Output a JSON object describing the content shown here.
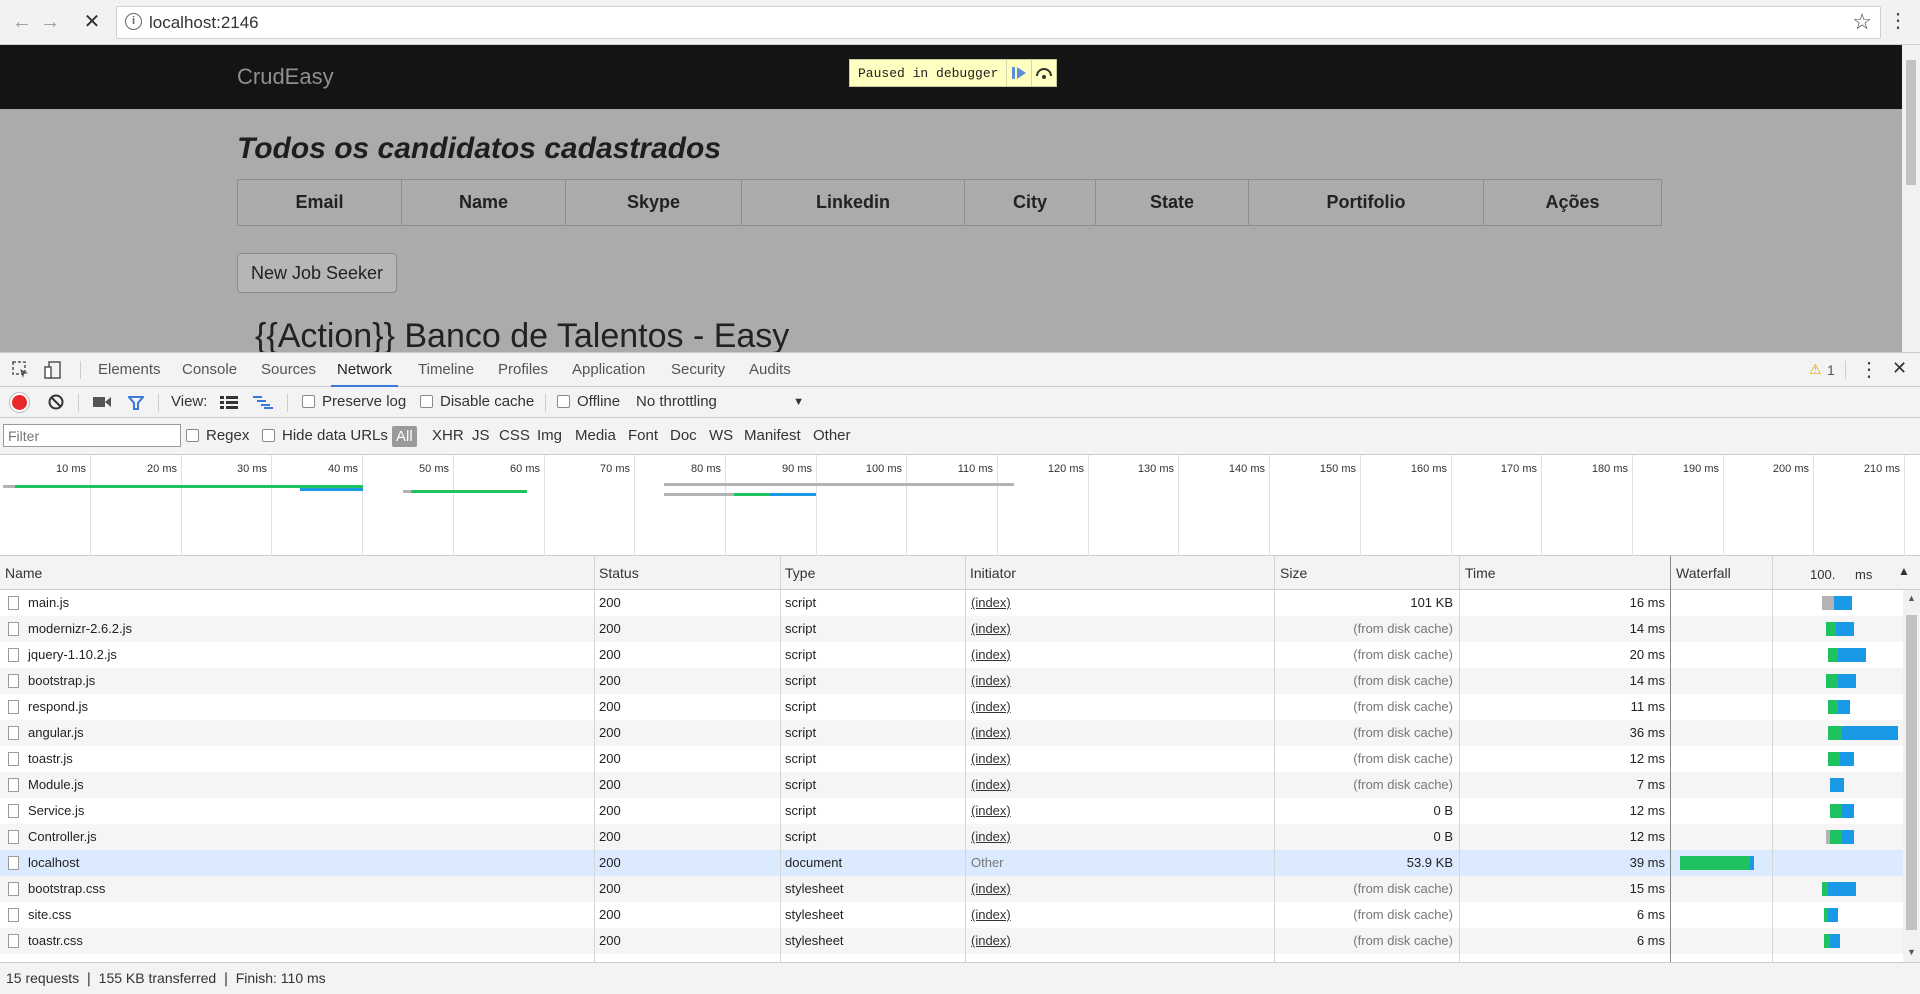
{
  "browser": {
    "url": "localhost:2146",
    "back_icon": "arrow-left-icon",
    "forward_icon": "arrow-right-icon",
    "stop_icon": "close-icon",
    "star_icon": "star-icon",
    "menu_icon": "kebab-icon"
  },
  "page": {
    "brand": "CrudEasy",
    "paused_label": "Paused in debugger",
    "title": "Todos os candidatos cadastrados",
    "columns": [
      "Email",
      "Name",
      "Skype",
      "Linkedin",
      "City",
      "State",
      "Portifolio",
      "Ações"
    ],
    "new_button": "New Job Seeker",
    "subtitle": "{{Action}} Banco de Talentos - Easy"
  },
  "devtools": {
    "tabs": [
      "Elements",
      "Console",
      "Sources",
      "Network",
      "Timeline",
      "Profiles",
      "Application",
      "Security",
      "Audits"
    ],
    "active_tab": "Network",
    "warning_count": "1",
    "toolbar": {
      "view_label": "View:",
      "preserve_log": "Preserve log",
      "disable_cache": "Disable cache",
      "offline": "Offline",
      "throttling": "No throttling"
    },
    "filter": {
      "placeholder": "Filter",
      "regex": "Regex",
      "hide_data_urls": "Hide data URLs",
      "types": [
        "All",
        "XHR",
        "JS",
        "CSS",
        "Img",
        "Media",
        "Font",
        "Doc",
        "WS",
        "Manifest",
        "Other"
      ]
    },
    "timeline_ticks": [
      "10 ms",
      "20 ms",
      "30 ms",
      "40 ms",
      "50 ms",
      "60 ms",
      "70 ms",
      "80 ms",
      "90 ms",
      "100 ms",
      "110 ms",
      "120 ms",
      "130 ms",
      "140 ms",
      "150 ms",
      "160 ms",
      "170 ms",
      "180 ms",
      "190 ms",
      "200 ms",
      "210 ms"
    ],
    "table_headers": {
      "name": "Name",
      "status": "Status",
      "type": "Type",
      "initiator": "Initiator",
      "size": "Size",
      "time": "Time",
      "waterfall": "Waterfall",
      "waterfall_scale": "100.",
      "waterfall_unit": "ms"
    },
    "requests": [
      {
        "name": "main.js",
        "status": "200",
        "type": "script",
        "initiator": "(index)",
        "size": "101 KB",
        "time": "16 ms"
      },
      {
        "name": "modernizr-2.6.2.js",
        "status": "200",
        "type": "script",
        "initiator": "(index)",
        "size": "(from disk cache)",
        "time": "14 ms"
      },
      {
        "name": "jquery-1.10.2.js",
        "status": "200",
        "type": "script",
        "initiator": "(index)",
        "size": "(from disk cache)",
        "time": "20 ms"
      },
      {
        "name": "bootstrap.js",
        "status": "200",
        "type": "script",
        "initiator": "(index)",
        "size": "(from disk cache)",
        "time": "14 ms"
      },
      {
        "name": "respond.js",
        "status": "200",
        "type": "script",
        "initiator": "(index)",
        "size": "(from disk cache)",
        "time": "11 ms"
      },
      {
        "name": "angular.js",
        "status": "200",
        "type": "script",
        "initiator": "(index)",
        "size": "(from disk cache)",
        "time": "36 ms"
      },
      {
        "name": "toastr.js",
        "status": "200",
        "type": "script",
        "initiator": "(index)",
        "size": "(from disk cache)",
        "time": "12 ms"
      },
      {
        "name": "Module.js",
        "status": "200",
        "type": "script",
        "initiator": "(index)",
        "size": "(from disk cache)",
        "time": "7 ms"
      },
      {
        "name": "Service.js",
        "status": "200",
        "type": "script",
        "initiator": "(index)",
        "size": "0 B",
        "time": "12 ms"
      },
      {
        "name": "Controller.js",
        "status": "200",
        "type": "script",
        "initiator": "(index)",
        "size": "0 B",
        "time": "12 ms"
      },
      {
        "name": "localhost",
        "status": "200",
        "type": "document",
        "initiator": "Other",
        "size": "53.9 KB",
        "time": "39 ms"
      },
      {
        "name": "bootstrap.css",
        "status": "200",
        "type": "stylesheet",
        "initiator": "(index)",
        "size": "(from disk cache)",
        "time": "15 ms"
      },
      {
        "name": "site.css",
        "status": "200",
        "type": "stylesheet",
        "initiator": "(index)",
        "size": "(from disk cache)",
        "time": "6 ms"
      },
      {
        "name": "toastr.css",
        "status": "200",
        "type": "stylesheet",
        "initiator": "(index)",
        "size": "(from disk cache)",
        "time": "6 ms"
      }
    ],
    "status_bar": "15 requests  ❘  155 KB transferred  ❘  Finish: 110 ms",
    "colors": {
      "green": "#1ec360",
      "blue": "#1a9ae6",
      "gray": "#b3b3b3",
      "record": "#e8282b",
      "selected": "#3879d9"
    }
  }
}
